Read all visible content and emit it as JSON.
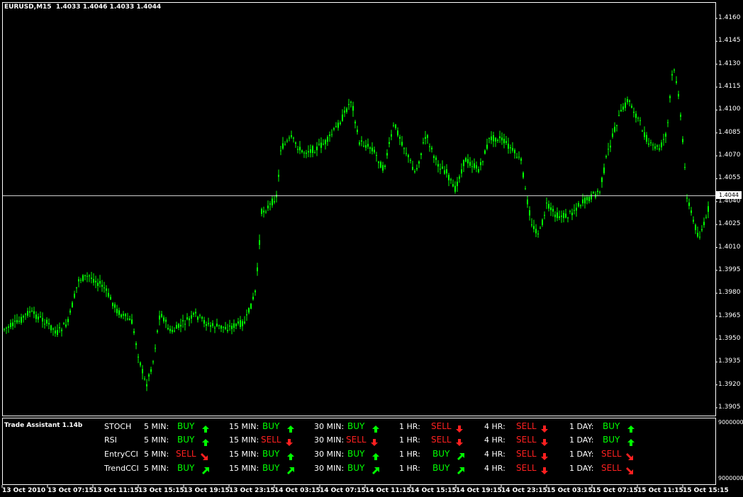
{
  "header": {
    "symbol_tf": "EURUSD,M15",
    "ohlc": "1.4033 1.4046 1.4033 1.4044"
  },
  "price_axis": {
    "labels": [
      "1.4160",
      "1.4145",
      "1.4130",
      "1.4115",
      "1.4100",
      "1.4085",
      "1.4070",
      "1.4055",
      "1.4040",
      "1.4025",
      "1.4010",
      "1.3995",
      "1.3980",
      "1.3965",
      "1.3950",
      "1.3935",
      "1.3920",
      "1.3905"
    ],
    "current_price": "1.4044"
  },
  "indicator_axis": {
    "top_label": "9000000",
    "bottom_label": "9000000"
  },
  "time_axis": {
    "labels": [
      "13 Oct 2010",
      "13 Oct 07:15",
      "13 Oct 11:15",
      "13 Oct 15:15",
      "13 Oct 19:15",
      "13 Oct 23:15",
      "14 Oct 03:15",
      "14 Oct 07:15",
      "14 Oct 11:15",
      "14 Oct 15:15",
      "14 Oct 19:15",
      "14 Oct 23:15",
      "15 Oct 03:15",
      "15 Oct 07:15",
      "15 Oct 11:15",
      "15 Oct 15:15"
    ]
  },
  "indicator": {
    "name": "Trade Assistant 1.14b",
    "timeframes": [
      "5 MIN:",
      "15 MIN:",
      "30 MIN:",
      "1 HR:",
      "4 HR:",
      "1 DAY:"
    ],
    "rows": [
      {
        "name": "STOCH",
        "signals": [
          {
            "text": "BUY",
            "dir": "up"
          },
          {
            "text": "BUY",
            "dir": "up"
          },
          {
            "text": "BUY",
            "dir": "up"
          },
          {
            "text": "SELL",
            "dir": "down"
          },
          {
            "text": "SELL",
            "dir": "down"
          },
          {
            "text": "BUY",
            "dir": "up"
          }
        ]
      },
      {
        "name": "RSI",
        "signals": [
          {
            "text": "BUY",
            "dir": "up"
          },
          {
            "text": "SELL",
            "dir": "down"
          },
          {
            "text": "SELL",
            "dir": "down"
          },
          {
            "text": "SELL",
            "dir": "down"
          },
          {
            "text": "SELL",
            "dir": "down"
          },
          {
            "text": "BUY",
            "dir": "up"
          }
        ]
      },
      {
        "name": "EntryCCI",
        "signals": [
          {
            "text": "SELL",
            "dir": "downright"
          },
          {
            "text": "BUY",
            "dir": "up"
          },
          {
            "text": "BUY",
            "dir": "up"
          },
          {
            "text": "BUY",
            "dir": "upright"
          },
          {
            "text": "SELL",
            "dir": "down"
          },
          {
            "text": "SELL",
            "dir": "downright"
          }
        ]
      },
      {
        "name": "TrendCCI",
        "signals": [
          {
            "text": "BUY",
            "dir": "upright"
          },
          {
            "text": "BUY",
            "dir": "upright"
          },
          {
            "text": "BUY",
            "dir": "upright"
          },
          {
            "text": "BUY",
            "dir": "upright"
          },
          {
            "text": "SELL",
            "dir": "down"
          },
          {
            "text": "SELL",
            "dir": "downright"
          }
        ]
      }
    ]
  },
  "colors": {
    "background": "#000000",
    "candle": "#00ff00",
    "buy": "#00ff00",
    "sell": "#ff2020",
    "frame": "#ffffff"
  }
}
